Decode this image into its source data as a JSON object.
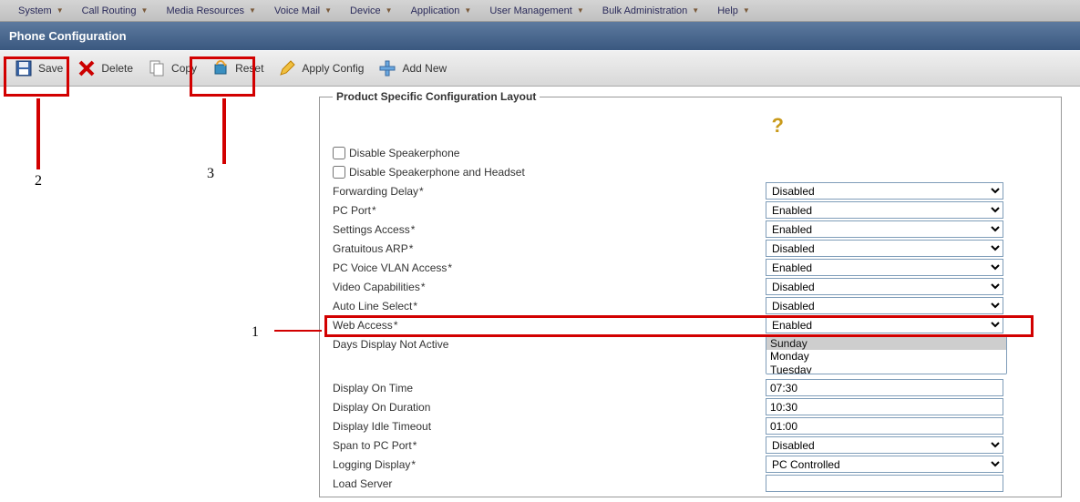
{
  "menubar": [
    {
      "label": "System"
    },
    {
      "label": "Call Routing"
    },
    {
      "label": "Media Resources"
    },
    {
      "label": "Voice Mail"
    },
    {
      "label": "Device"
    },
    {
      "label": "Application"
    },
    {
      "label": "User Management"
    },
    {
      "label": "Bulk Administration"
    },
    {
      "label": "Help"
    }
  ],
  "header": {
    "title": "Phone Configuration"
  },
  "toolbar": {
    "save": "Save",
    "delete": "Delete",
    "copy": "Copy",
    "reset": "Reset",
    "apply": "Apply Config",
    "addnew": "Add New"
  },
  "panel_legend": "Product Specific Configuration Layout",
  "rows": {
    "disable_speakerphone": "Disable Speakerphone",
    "disable_speakerphone_headset": "Disable Speakerphone and Headset",
    "forwarding_delay": "Forwarding Delay",
    "pc_port": "PC Port ",
    "settings_access": "Settings Access",
    "gratuitous_arp": "Gratuitous ARP",
    "pc_voice_vlan": "PC Voice VLAN Access",
    "video_capabilities": "Video Capabilities",
    "auto_line_select": "Auto Line Select",
    "web_access": "Web Access",
    "days_display": "Days Display Not Active",
    "display_on_time": "Display On Time",
    "display_on_duration": "Display On Duration",
    "display_idle_timeout": "Display Idle Timeout",
    "span_pc_port": "Span to PC Port",
    "logging_display": "Logging Display",
    "load_server": "Load Server"
  },
  "values": {
    "forwarding_delay": "Disabled",
    "pc_port": "Enabled",
    "settings_access": "Enabled",
    "gratuitous_arp": "Disabled",
    "pc_voice_vlan": "Enabled",
    "video_capabilities": "Disabled",
    "auto_line_select": "Disabled",
    "web_access": "Enabled",
    "days": [
      "Sunday",
      "Monday",
      "Tuesday"
    ],
    "display_on_time": "07:30",
    "display_on_duration": "10:30",
    "display_idle_timeout": "01:00",
    "span_pc_port": "Disabled",
    "logging_display": "PC Controlled",
    "load_server": ""
  },
  "annotations": {
    "n1": "1",
    "n2": "2",
    "n3": "3"
  }
}
